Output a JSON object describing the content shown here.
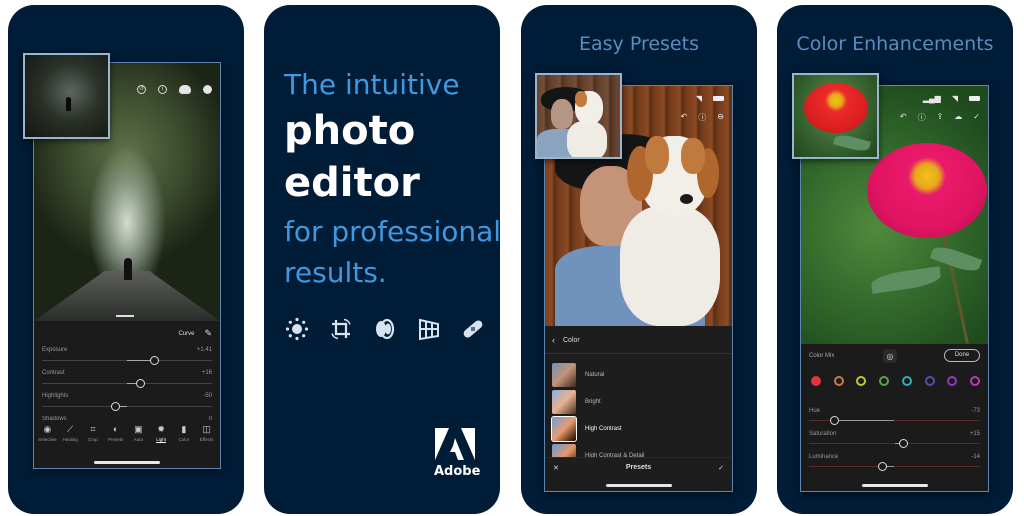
{
  "cards": {
    "edit": {
      "toolbar_icons": [
        "history-icon",
        "info-icon",
        "cloud-sync-icon",
        "more-icon"
      ],
      "curve_label": "Curve",
      "sliders": [
        {
          "label": "Exposure",
          "value": "+1.41",
          "position": 0.66
        },
        {
          "label": "Contrast",
          "value": "+16",
          "position": 0.58
        },
        {
          "label": "Highlights",
          "value": "-50",
          "position": 0.43
        },
        {
          "label": "Shadows",
          "value": "0",
          "position": 0.5
        }
      ],
      "tools": [
        {
          "label": "Selective",
          "icon": "◉"
        },
        {
          "label": "Healing",
          "icon": "⟋"
        },
        {
          "label": "Crop",
          "icon": "⌗"
        },
        {
          "label": "Presets",
          "icon": "◐"
        },
        {
          "label": "Auto",
          "icon": "▣"
        },
        {
          "label": "Light",
          "icon": "✹",
          "active": true
        },
        {
          "label": "Color",
          "icon": "▮"
        },
        {
          "label": "Effects",
          "icon": "◫"
        }
      ]
    },
    "promo": {
      "line1": "The intuitive",
      "line2": "photo",
      "line3": "editor",
      "line4": "for professional",
      "line5": "results.",
      "feature_icons": [
        "light-icon",
        "crop-icon",
        "lens-icon",
        "geometry-icon",
        "healing-bandage-icon"
      ],
      "brand": "Adobe"
    },
    "presets": {
      "title": "Easy Presets",
      "panel_title": "Color",
      "items": [
        {
          "name": "Natural",
          "selected": false
        },
        {
          "name": "Bright",
          "selected": false
        },
        {
          "name": "High Contrast",
          "selected": true
        },
        {
          "name": "High Contrast & Detail",
          "selected": false
        }
      ],
      "footer_label": "Presets",
      "cancel_glyph": "✕",
      "confirm_glyph": "✓"
    },
    "color": {
      "title": "Color Enhancements",
      "panel_title": "Color Mix",
      "done_label": "Done",
      "swatches": [
        {
          "name": "red",
          "color": "#e2363c",
          "selected": true
        },
        {
          "name": "orange",
          "color": "#c67c47"
        },
        {
          "name": "yellow",
          "color": "#c9c43c"
        },
        {
          "name": "green",
          "color": "#5ea04c"
        },
        {
          "name": "aqua",
          "color": "#2fb0b4"
        },
        {
          "name": "blue",
          "color": "#4a54b0"
        },
        {
          "name": "purple",
          "color": "#9a34c4"
        },
        {
          "name": "magenta",
          "color": "#b53ab8"
        }
      ],
      "sliders": [
        {
          "label": "Hue",
          "value": "-73",
          "position": 0.15
        },
        {
          "label": "Saturation",
          "value": "+15",
          "position": 0.55
        },
        {
          "label": "Luminance",
          "value": "-14",
          "position": 0.43
        }
      ]
    }
  },
  "colors": {
    "card_bg": "#011c37",
    "headline_blue": "#3f98e0",
    "title_blue": "#5a8cc0"
  }
}
